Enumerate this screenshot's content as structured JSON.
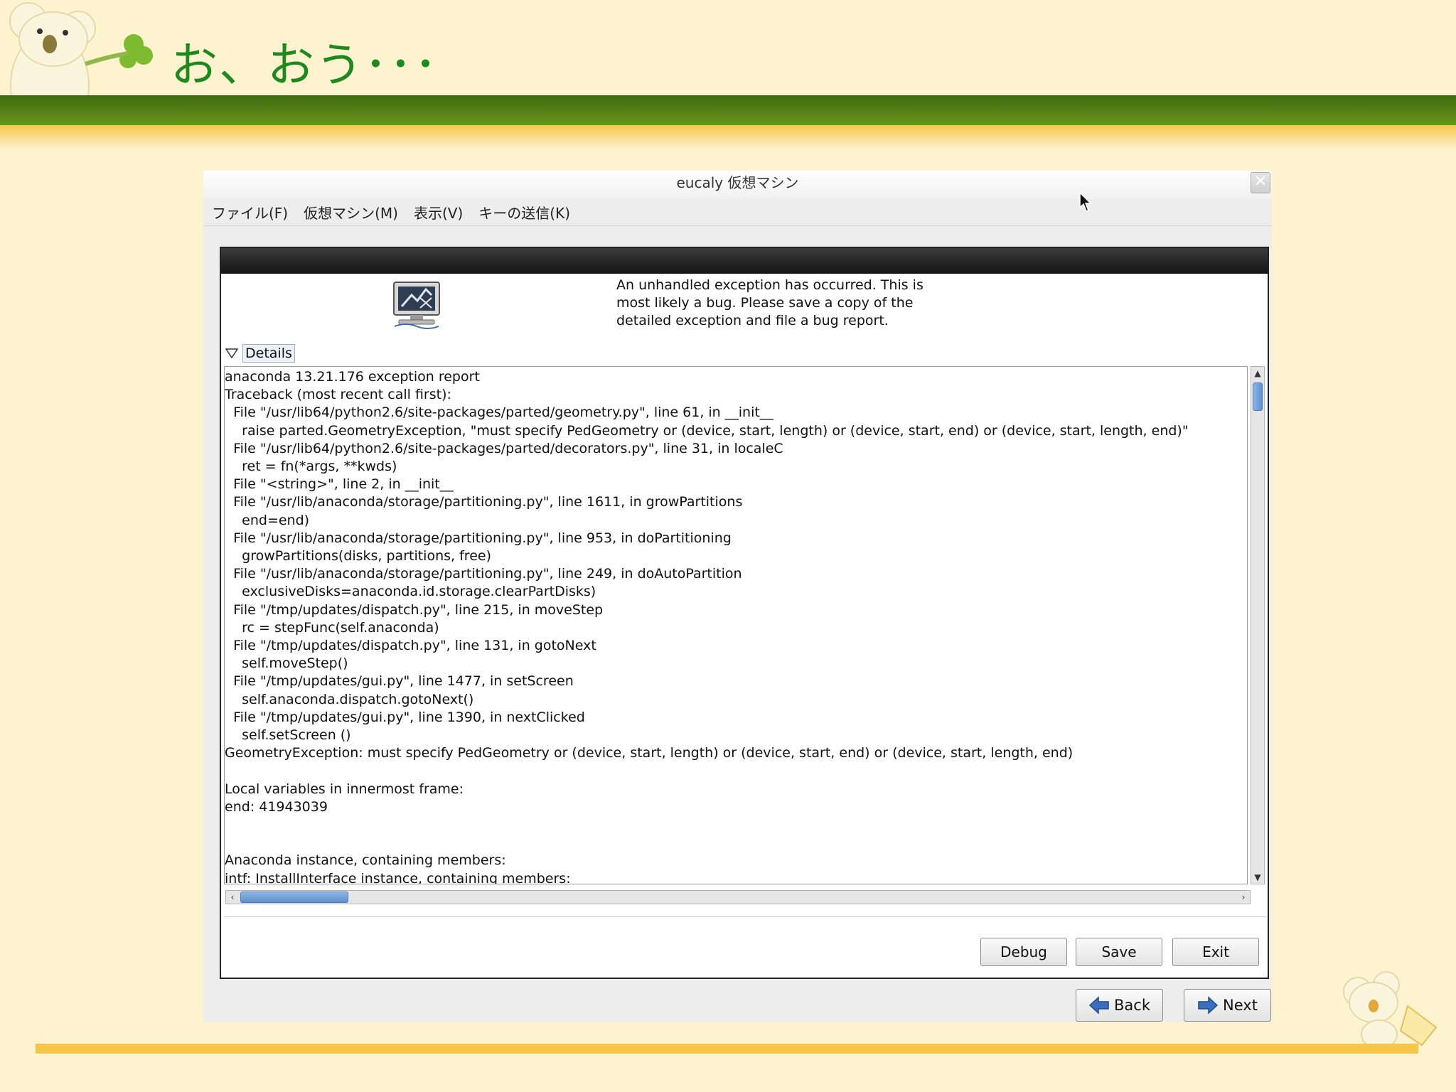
{
  "slide": {
    "title": "お、おう･･･"
  },
  "vm_window": {
    "title": "eucaly 仮想マシン",
    "menu": [
      "ファイル(F)",
      "仮想マシン(M)",
      "表示(V)",
      "キーの送信(K)"
    ]
  },
  "dialog": {
    "message": "An unhandled exception has occurred.  This is\nmost likely a bug.  Please save a copy of the\ndetailed exception and file a bug report.",
    "details_label": "Details",
    "details_text": "anaconda 13.21.176 exception report\nTraceback (most recent call first):\n  File \"/usr/lib64/python2.6/site-packages/parted/geometry.py\", line 61, in __init__\n    raise parted.GeometryException, \"must specify PedGeometry or (device, start, length) or (device, start, end) or (device, start, length, end)\"\n  File \"/usr/lib64/python2.6/site-packages/parted/decorators.py\", line 31, in localeC\n    ret = fn(*args, **kwds)\n  File \"<string>\", line 2, in __init__\n  File \"/usr/lib/anaconda/storage/partitioning.py\", line 1611, in growPartitions\n    end=end)\n  File \"/usr/lib/anaconda/storage/partitioning.py\", line 953, in doPartitioning\n    growPartitions(disks, partitions, free)\n  File \"/usr/lib/anaconda/storage/partitioning.py\", line 249, in doAutoPartition\n    exclusiveDisks=anaconda.id.storage.clearPartDisks)\n  File \"/tmp/updates/dispatch.py\", line 215, in moveStep\n    rc = stepFunc(self.anaconda)\n  File \"/tmp/updates/dispatch.py\", line 131, in gotoNext\n    self.moveStep()\n  File \"/tmp/updates/gui.py\", line 1477, in setScreen\n    self.anaconda.dispatch.gotoNext()\n  File \"/tmp/updates/gui.py\", line 1390, in nextClicked\n    self.setScreen ()\nGeometryException: must specify PedGeometry or (device, start, length) or (device, start, end) or (device, start, length, end)\n\nLocal variables in innermost frame:\nend: 41943039\n\n\nAnaconda instance, containing members:\nintf: InstallInterface instance, containing members:",
    "buttons": {
      "debug": "Debug",
      "save": "Save",
      "exit": "Exit"
    }
  },
  "navigation": {
    "back": "Back",
    "next": "Next"
  },
  "icons": {
    "close": "close-icon",
    "expander": "triangle-down-icon",
    "monitor": "computer-crash-icon",
    "back": "arrow-left-icon",
    "next": "arrow-right-icon"
  },
  "colors": {
    "slide_background": "#fdf3cf",
    "slide_title": "#1e8a1e",
    "band_dark": "#4a7410",
    "band_light": "#f7c549",
    "installer_topbar": "#1e1e1e",
    "scroll_thumb": "#6c9bd6"
  }
}
